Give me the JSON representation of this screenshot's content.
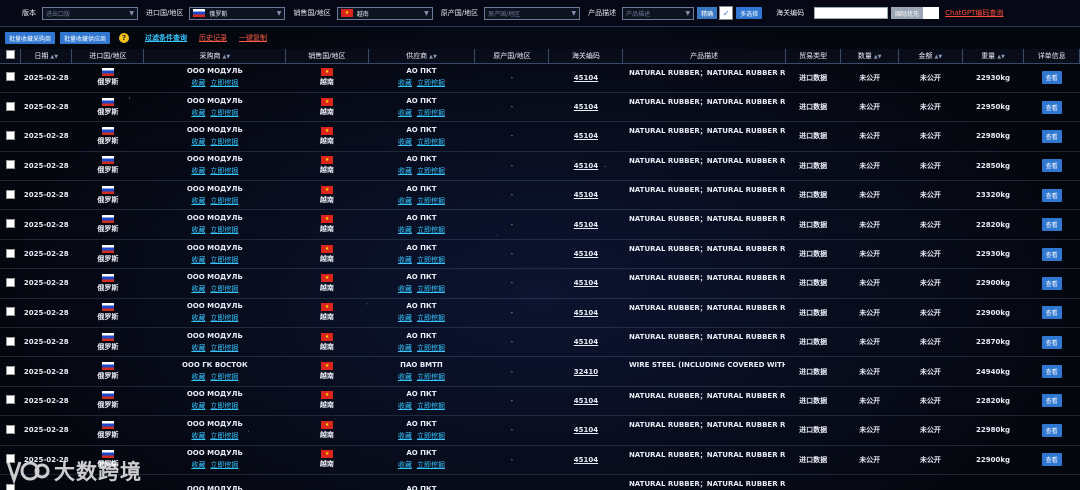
{
  "filters": {
    "version_label": "版本",
    "version_placeholder": "进出口版",
    "import_country_label": "进口国/地区",
    "import_country_value": "俄罗斯",
    "sales_country_label": "销售国/地区",
    "sales_country_value": "越南",
    "origin_country_label": "原产国/地区",
    "origin_country_placeholder": "原产国/地区",
    "product_desc_label": "产品描述",
    "product_desc_placeholder": "产品描述",
    "precise_label": "精确",
    "precise_checked": "✓",
    "multi_select_label": "多选择",
    "hs_code_label": "海关编码",
    "hs_code_value": "",
    "hs_code_button": "国际优先",
    "chatgpt_link": "ChatGPT编码查询"
  },
  "actions": {
    "bulk_save_buyer": "批量收藏采购商",
    "bulk_save_supplier": "批量收藏供应商",
    "warn_icon": "?",
    "filter_query": "过滤条件查询",
    "history": "历史记录",
    "copy_all": "一键复制"
  },
  "columns": [
    "日期",
    "进口国/地区",
    "采购商",
    "销售国/地区",
    "供应商",
    "原产国/地区",
    "海关编码",
    "产品描述",
    "贸易类型",
    "数量",
    "金额",
    "重量",
    "详单信息"
  ],
  "row_links": {
    "save": "收藏",
    "mine": "立即挖掘"
  },
  "view_label": "查看",
  "rows": [
    {
      "date": "2025-02-28",
      "import_country": "俄罗斯",
      "buyer": "ООО МОДУЛЬ",
      "sales_country": "越南",
      "supplier": "АО ПКТ",
      "origin": "-",
      "hs": "45104",
      "desc": "NATURAL RUBBER；NATURAL RUBBER RUBI",
      "trade": "进口数据",
      "qty": "未公开",
      "amount": "未公开",
      "weight": "22930kg"
    },
    {
      "date": "2025-02-28",
      "import_country": "俄罗斯",
      "buyer": "ООО МОДУЛЬ",
      "sales_country": "越南",
      "supplier": "АО ПКТ",
      "origin": "-",
      "hs": "45104",
      "desc": "NATURAL RUBBER；NATURAL RUBBER RUBI",
      "trade": "进口数据",
      "qty": "未公开",
      "amount": "未公开",
      "weight": "22950kg"
    },
    {
      "date": "2025-02-28",
      "import_country": "俄罗斯",
      "buyer": "ООО МОДУЛЬ",
      "sales_country": "越南",
      "supplier": "АО ПКТ",
      "origin": "-",
      "hs": "45104",
      "desc": "NATURAL RUBBER；NATURAL RUBBER RUBI",
      "trade": "进口数据",
      "qty": "未公开",
      "amount": "未公开",
      "weight": "22980kg"
    },
    {
      "date": "2025-02-28",
      "import_country": "俄罗斯",
      "buyer": "ООО МОДУЛЬ",
      "sales_country": "越南",
      "supplier": "АО ПКТ",
      "origin": "-",
      "hs": "45104",
      "desc": "NATURAL RUBBER；NATURAL RUBBER RUBI",
      "trade": "进口数据",
      "qty": "未公开",
      "amount": "未公开",
      "weight": "22850kg"
    },
    {
      "date": "2025-02-28",
      "import_country": "俄罗斯",
      "buyer": "ООО МОДУЛЬ",
      "sales_country": "越南",
      "supplier": "АО ПКТ",
      "origin": "-",
      "hs": "45104",
      "desc": "NATURAL RUBBER；NATURAL RUBBER RUBI",
      "trade": "进口数据",
      "qty": "未公开",
      "amount": "未公开",
      "weight": "23320kg"
    },
    {
      "date": "2025-02-28",
      "import_country": "俄罗斯",
      "buyer": "ООО МОДУЛЬ",
      "sales_country": "越南",
      "supplier": "АО ПКТ",
      "origin": "-",
      "hs": "45104",
      "desc": "NATURAL RUBBER；NATURAL RUBBER RUBI",
      "trade": "进口数据",
      "qty": "未公开",
      "amount": "未公开",
      "weight": "22820kg"
    },
    {
      "date": "2025-02-28",
      "import_country": "俄罗斯",
      "buyer": "ООО МОДУЛЬ",
      "sales_country": "越南",
      "supplier": "АО ПКТ",
      "origin": "-",
      "hs": "45104",
      "desc": "NATURAL RUBBER；NATURAL RUBBER RUBI",
      "trade": "进口数据",
      "qty": "未公开",
      "amount": "未公开",
      "weight": "22930kg"
    },
    {
      "date": "2025-02-28",
      "import_country": "俄罗斯",
      "buyer": "ООО МОДУЛЬ",
      "sales_country": "越南",
      "supplier": "АО ПКТ",
      "origin": "-",
      "hs": "45104",
      "desc": "NATURAL RUBBER；NATURAL RUBBER RUBI",
      "trade": "进口数据",
      "qty": "未公开",
      "amount": "未公开",
      "weight": "22900kg"
    },
    {
      "date": "2025-02-28",
      "import_country": "俄罗斯",
      "buyer": "ООО МОДУЛЬ",
      "sales_country": "越南",
      "supplier": "АО ПКТ",
      "origin": "-",
      "hs": "45104",
      "desc": "NATURAL RUBBER；NATURAL RUBBER RUBI",
      "trade": "进口数据",
      "qty": "未公开",
      "amount": "未公开",
      "weight": "22900kg"
    },
    {
      "date": "2025-02-28",
      "import_country": "俄罗斯",
      "buyer": "ООО МОДУЛЬ",
      "sales_country": "越南",
      "supplier": "АО ПКТ",
      "origin": "-",
      "hs": "45104",
      "desc": "NATURAL RUBBER；NATURAL RUBBER RUBI",
      "trade": "进口数据",
      "qty": "未公开",
      "amount": "未公开",
      "weight": "22870kg"
    },
    {
      "date": "2025-02-28",
      "import_country": "俄罗斯",
      "buyer": "ООО ГК ВОСТОК",
      "sales_country": "越南",
      "supplier": "ПАО ВМТП",
      "origin": "-",
      "hs": "32410",
      "desc": "WIRE STEEL (INCLUDING COVERED WITH OTI",
      "trade": "进口数据",
      "qty": "未公开",
      "amount": "未公开",
      "weight": "24940kg"
    },
    {
      "date": "2025-02-28",
      "import_country": "俄罗斯",
      "buyer": "ООО МОДУЛЬ",
      "sales_country": "越南",
      "supplier": "АО ПКТ",
      "origin": "-",
      "hs": "45104",
      "desc": "NATURAL RUBBER；NATURAL RUBBER RUBI",
      "trade": "进口数据",
      "qty": "未公开",
      "amount": "未公开",
      "weight": "22820kg"
    },
    {
      "date": "2025-02-28",
      "import_country": "俄罗斯",
      "buyer": "ООО МОДУЛЬ",
      "sales_country": "越南",
      "supplier": "АО ПКТ",
      "origin": "-",
      "hs": "45104",
      "desc": "NATURAL RUBBER；NATURAL RUBBER RUBI",
      "trade": "进口数据",
      "qty": "未公开",
      "amount": "未公开",
      "weight": "22980kg"
    },
    {
      "date": "2025-02-28",
      "import_country": "俄罗斯",
      "buyer": "ООО МОДУЛЬ",
      "sales_country": "越南",
      "supplier": "АО ПКТ",
      "origin": "-",
      "hs": "45104",
      "desc": "NATURAL RUBBER；NATURAL RUBBER RUBI",
      "trade": "进口数据",
      "qty": "未公开",
      "amount": "未公开",
      "weight": "22900kg"
    },
    {
      "date": "",
      "import_country": "",
      "buyer": "ООО МОДУЛЬ",
      "sales_country": "",
      "supplier": "АО ПКТ",
      "origin": "",
      "hs": "",
      "desc": "NATURAL RUBBER；NATURAL RUBBER RUBI",
      "trade": "",
      "qty": "",
      "amount": "",
      "weight": ""
    }
  ],
  "watermark": {
    "text": "大数跨境"
  }
}
